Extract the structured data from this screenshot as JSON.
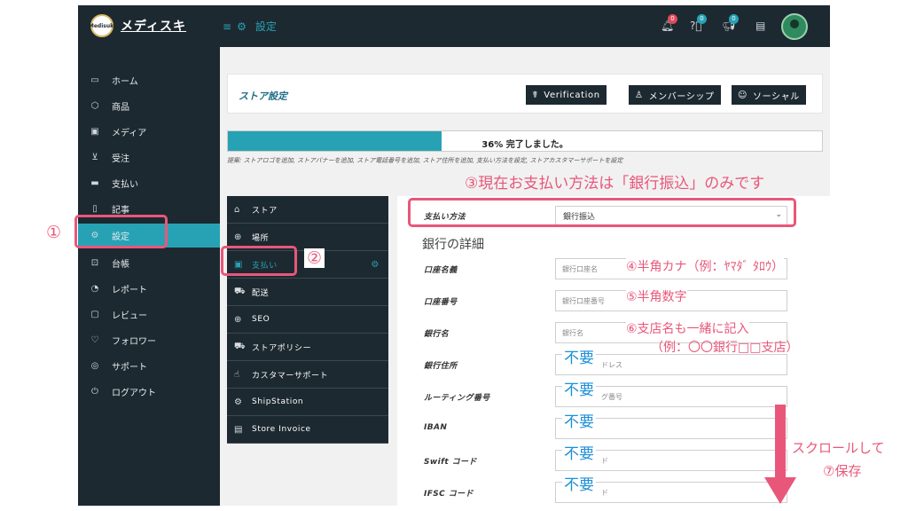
{
  "topbar": {
    "logo_text": "Medisuki",
    "brand": "メディスキ",
    "breadcrumb": "設定",
    "badges": {
      "notifications": "0",
      "help": "0",
      "announcements": "0"
    }
  },
  "sidebar": {
    "items": [
      {
        "label": "ホーム",
        "icon": "monitor-icon"
      },
      {
        "label": "商品",
        "icon": "box-icon"
      },
      {
        "label": "メディア",
        "icon": "image-icon"
      },
      {
        "label": "受注",
        "icon": "cart-icon"
      },
      {
        "label": "支払い",
        "icon": "card-icon"
      },
      {
        "label": "記事",
        "icon": "document-icon"
      },
      {
        "label": "設定",
        "icon": "gears-icon",
        "active": true
      },
      {
        "label": "台帳",
        "icon": "money-icon"
      },
      {
        "label": "レポート",
        "icon": "chart-icon"
      },
      {
        "label": "レビュー",
        "icon": "comment-icon"
      },
      {
        "label": "フォロワー",
        "icon": "heart-icon"
      },
      {
        "label": "サポート",
        "icon": "lifebuoy-icon"
      },
      {
        "label": "ログアウト",
        "icon": "power-icon"
      }
    ]
  },
  "store_header": {
    "title": "ストア設定",
    "buttons": {
      "verification": "Verification",
      "membership": "メンバーシップ",
      "social": "ソーシャル"
    }
  },
  "progress": {
    "percent": 36,
    "text": "36% 完了しました。"
  },
  "hint": "提案: ストアロゴを追加, ストアバナーを追加, ストア電話番号を追加, ストア住所を追加, 支払い方法を設定, ストアカスタマーサポートを設定",
  "settings_menu": [
    {
      "label": "ストア",
      "icon": "store-icon"
    },
    {
      "label": "場所",
      "icon": "globe-icon"
    },
    {
      "label": "支払い",
      "icon": "money-icon",
      "active": true
    },
    {
      "label": "配送",
      "icon": "truck-icon"
    },
    {
      "label": "SEO",
      "icon": "globe-icon"
    },
    {
      "label": "ストアポリシー",
      "icon": "truck-icon"
    },
    {
      "label": "カスタマーサポート",
      "icon": "thumbs-up-icon"
    },
    {
      "label": "ShipStation",
      "icon": "gear-icon"
    },
    {
      "label": "Store Invoice",
      "icon": "invoice-icon"
    }
  ],
  "payment": {
    "method_label": "支払い方法",
    "method_value": "銀行振込",
    "bank_heading": "銀行の詳細",
    "fields": [
      {
        "label": "口座名義",
        "placeholder": "銀行口座名"
      },
      {
        "label": "口座番号",
        "placeholder": "銀行口座番号"
      },
      {
        "label": "銀行名",
        "placeholder": "銀行名"
      },
      {
        "label": "銀行住所",
        "placeholder": "ドレス"
      },
      {
        "label": "ルーティング番号",
        "placeholder": "グ番号"
      },
      {
        "label": "IBAN",
        "placeholder": ""
      },
      {
        "label": "Swift コード",
        "placeholder": "ド"
      },
      {
        "label": "IFSC コード",
        "placeholder": "ド"
      }
    ]
  },
  "annotations": {
    "step1": "①",
    "step2": "②",
    "step3": "③現在お支払い方法は「銀行振込」のみです",
    "step4": "④半角カナ（例：ﾔﾏﾀﾞ ﾀﾛｳ）",
    "step5": "⑤半角数字",
    "step6_line1": "⑥支店名も一緒に記入",
    "step6_line2": "（例：〇〇銀行□□支店）",
    "not_required": "不要",
    "scroll_line1": "スクロールして",
    "scroll_line2": "⑦保存"
  },
  "colors": {
    "accent": "#27a2b5",
    "dark": "#1d2930",
    "annotation": "#e8577a",
    "not_required": "#1d8fd8"
  }
}
